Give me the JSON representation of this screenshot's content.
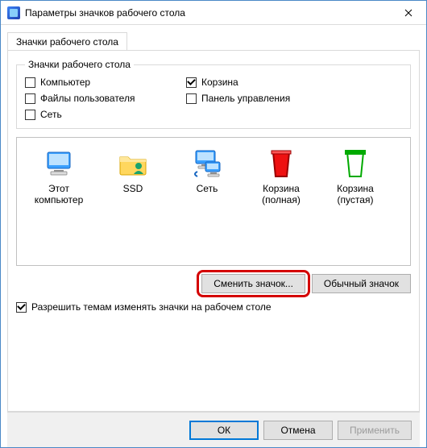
{
  "window": {
    "title": "Параметры значков рабочего стола"
  },
  "tabs": [
    {
      "label": "Значки рабочего стола",
      "active": true
    }
  ],
  "group": {
    "legend": "Значки рабочего стола",
    "checkboxes": {
      "computer": {
        "label": "Компьютер",
        "checked": false
      },
      "recyclebin": {
        "label": "Корзина",
        "checked": true
      },
      "userfiles": {
        "label": "Файлы пользователя",
        "checked": false
      },
      "cpl": {
        "label": "Панель управления",
        "checked": false
      },
      "network": {
        "label": "Сеть",
        "checked": false
      }
    }
  },
  "icons": [
    {
      "id": "this-pc",
      "label": "Этот компьютер",
      "glyph": "monitor-icon"
    },
    {
      "id": "ssd",
      "label": "SSD",
      "glyph": "folder-user-icon"
    },
    {
      "id": "network",
      "label": "Сеть",
      "glyph": "network-monitor-icon"
    },
    {
      "id": "bin-full",
      "label": "Корзина (полная)",
      "glyph": "bin-full-icon"
    },
    {
      "id": "bin-empty",
      "label": "Корзина (пустая)",
      "glyph": "bin-empty-icon"
    }
  ],
  "buttons": {
    "change_icon": "Сменить значок...",
    "default_icon": "Обычный значок"
  },
  "allow_themes": {
    "label": "Разрешить темам изменять значки на рабочем столе",
    "checked": true
  },
  "footer": {
    "ok": "ОК",
    "cancel": "Отмена",
    "apply": "Применить"
  }
}
